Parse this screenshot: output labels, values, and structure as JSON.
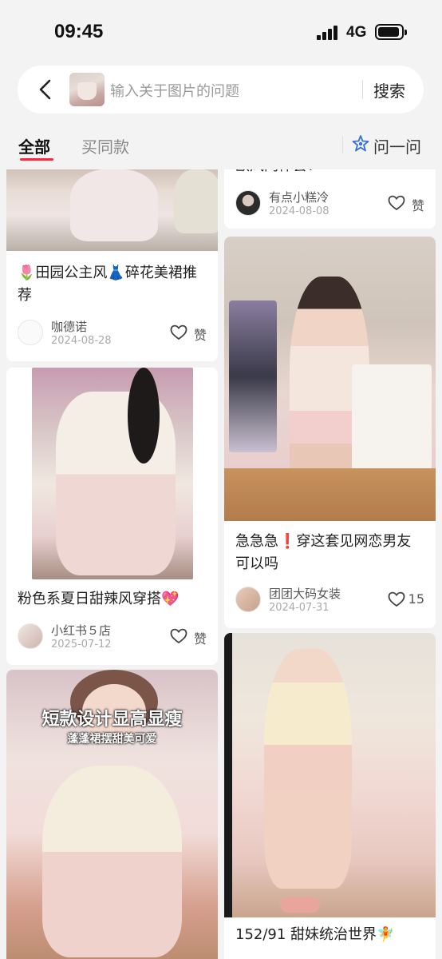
{
  "status_bar": {
    "time": "09:45",
    "network": "4G"
  },
  "search": {
    "placeholder": "输入关于图片的问题",
    "button_label": "搜索"
  },
  "tabs": {
    "all": "全部",
    "same_style": "买同款",
    "ask": "问一问"
  },
  "cards": [
    {
      "title_top": "",
      "title": "🌷田园公主风👗碎花美裙推荐",
      "author": "咖德诺",
      "date": "2024-08-28",
      "likes": "赞"
    },
    {
      "title": "欧风网伴套?",
      "author": "有点小糕冷",
      "date": "2024-08-08",
      "likes": "赞"
    },
    {
      "title": "粉色系夏日甜辣风穿搭💖",
      "author": "小红书５店",
      "date": "2025-07-12",
      "likes": "赞"
    },
    {
      "title": "急急急❗️穿这套见网恋男友可以吗",
      "author": "团团大码女装",
      "date": "2024-07-31",
      "likes": "15"
    },
    {
      "overlay_title": "短款设计显高显瘦",
      "overlay_subtitle": "蓬蓬裙摆甜美可爱"
    },
    {
      "title": "152/91 甜妹统治世界🧚"
    }
  ]
}
